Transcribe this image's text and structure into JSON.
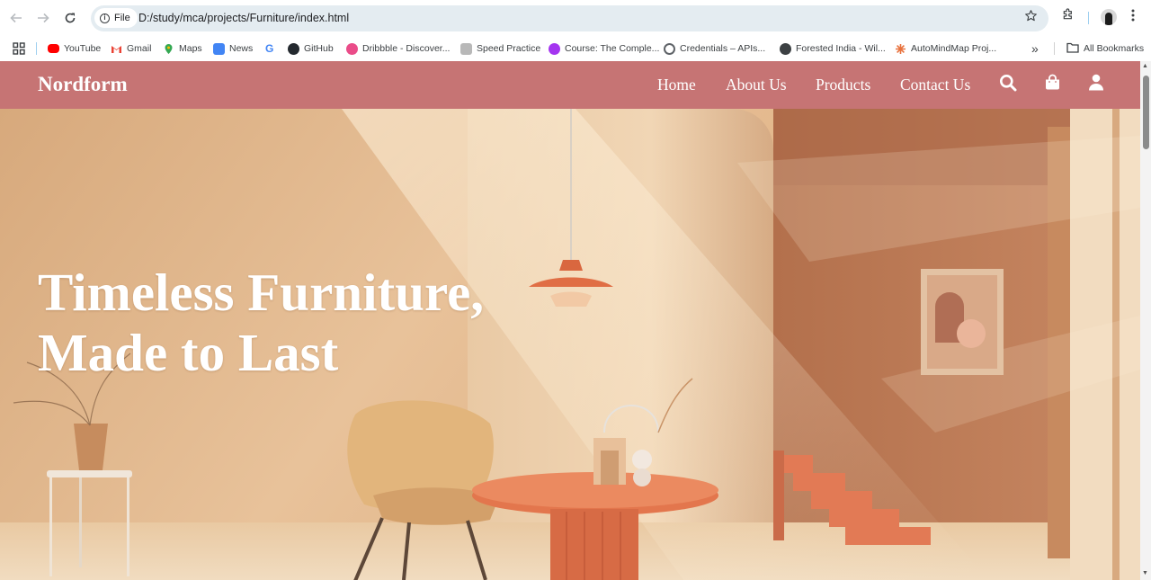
{
  "browser": {
    "url_chip": "File",
    "url": "D:/study/mca/projects/Furniture/index.html",
    "icons": [
      "back-arrow-icon",
      "forward-arrow-icon",
      "reload-icon",
      "info-icon",
      "star-icon",
      "extensions-icon",
      "profile-avatar",
      "kebab-menu-icon"
    ]
  },
  "bookmarks": {
    "items": [
      {
        "label": "YouTube",
        "icon": "youtube-icon",
        "color": "#ff0000"
      },
      {
        "label": "Gmail",
        "icon": "gmail-icon",
        "color": "#ea4335"
      },
      {
        "label": "Maps",
        "icon": "maps-icon",
        "color": "#34a853"
      },
      {
        "label": "News",
        "icon": "news-icon",
        "color": "#4285f4"
      },
      {
        "label": "",
        "icon": "google-icon",
        "color": "#4285f4"
      },
      {
        "label": "GitHub",
        "icon": "github-icon",
        "color": "#24292f"
      },
      {
        "label": "Dribbble - Discover...",
        "icon": "dribbble-icon",
        "color": "#ea4c89"
      },
      {
        "label": "Speed Practice",
        "icon": "speed-practice-icon",
        "color": "#8a8a8a"
      },
      {
        "label": "Course: The Comple...",
        "icon": "course-icon",
        "color": "#a435f0"
      },
      {
        "label": "Credentials – APIs...",
        "icon": "credentials-icon",
        "color": "#5f6368"
      },
      {
        "label": "Forested India - Wil...",
        "icon": "globe-icon",
        "color": "#3c4043"
      },
      {
        "label": "AutoMindMap Proj...",
        "icon": "automindmap-icon",
        "color": "#e8713c"
      }
    ],
    "overflow": "»",
    "all_bookmarks": "All Bookmarks"
  },
  "site": {
    "brand": "Nordform",
    "nav": [
      "Home",
      "About Us",
      "Products",
      "Contact Us"
    ],
    "nav_icons": [
      "search-icon",
      "shopping-bag-icon",
      "user-icon"
    ],
    "hero_title": "Timeless Furniture, Made to Last",
    "colors": {
      "navbar": "#c67474",
      "hero_wall": "#e3b98e",
      "accent": "#e0714b"
    }
  }
}
